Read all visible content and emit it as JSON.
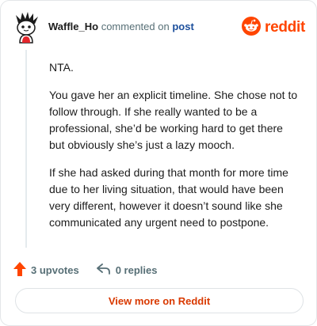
{
  "header": {
    "username": "Waffle_Ho",
    "commented_on": "commented on",
    "post_link": "post",
    "brand_name": "reddit"
  },
  "comment": {
    "paragraphs": [
      "NTA.",
      "You gave her an explicit timeline. She chose not to follow through. If she really wanted to be a professional, she’d be working hard to get there but obviously she’s just a lazy mooch.",
      "If she had asked during that month for more time due to her living situation, that would have been very different, however it doesn’t sound like she communicated any urgent need to postpone."
    ]
  },
  "actions": {
    "upvotes_label": "3 upvotes",
    "replies_label": "0 replies"
  },
  "footer": {
    "view_more_label": "View more on Reddit"
  },
  "colors": {
    "brand": "#ff4500",
    "upvote": "#ff4500",
    "link": "#1c4f9c",
    "view_more": "#d93900"
  },
  "icons": {
    "avatar": "snoo-avatar-icon",
    "brand": "reddit-logo-icon",
    "upvote": "upvote-arrow-icon",
    "reply": "reply-arrow-icon"
  }
}
